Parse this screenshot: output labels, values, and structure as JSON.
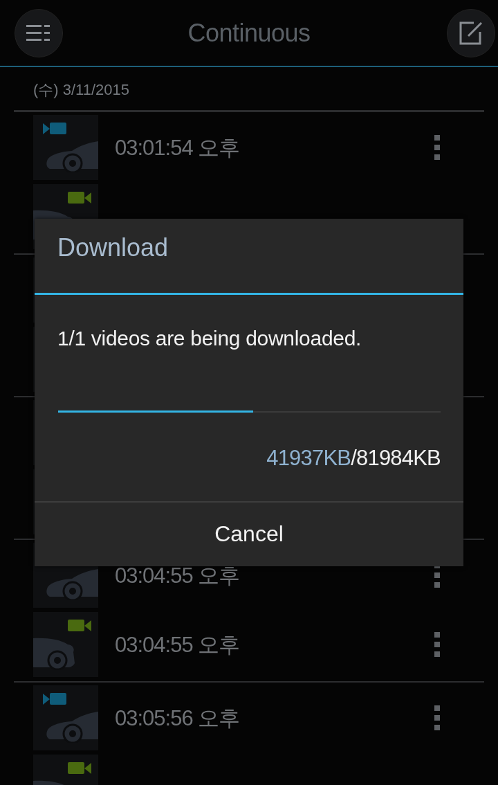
{
  "header": {
    "title": "Continuous"
  },
  "date_header": "(수) 3/11/2015",
  "groups": [
    {
      "items": [
        {
          "kind": "front",
          "time": "03:01:54 오후"
        },
        {
          "kind": "rear"
        }
      ]
    },
    {
      "items": [
        {
          "kind": "covered"
        },
        {
          "kind": "covered"
        }
      ]
    },
    {
      "items": [
        {
          "kind": "covered"
        },
        {
          "kind": "covered"
        }
      ]
    },
    {
      "items": [
        {
          "kind": "front",
          "time": "03:04:55 오후"
        },
        {
          "kind": "rear",
          "time": "03:04:55 오후"
        }
      ]
    },
    {
      "items": [
        {
          "kind": "front",
          "time": "03:05:56 오후"
        },
        {
          "kind": "rear"
        }
      ]
    }
  ],
  "dialog": {
    "title": "Download",
    "message": "1/1 videos are being downloaded.",
    "progress": {
      "level": 0.51
    },
    "downloaded": "41937KB",
    "separator": "/",
    "total": "81984KB",
    "buttons": [
      "Cancel"
    ]
  }
}
